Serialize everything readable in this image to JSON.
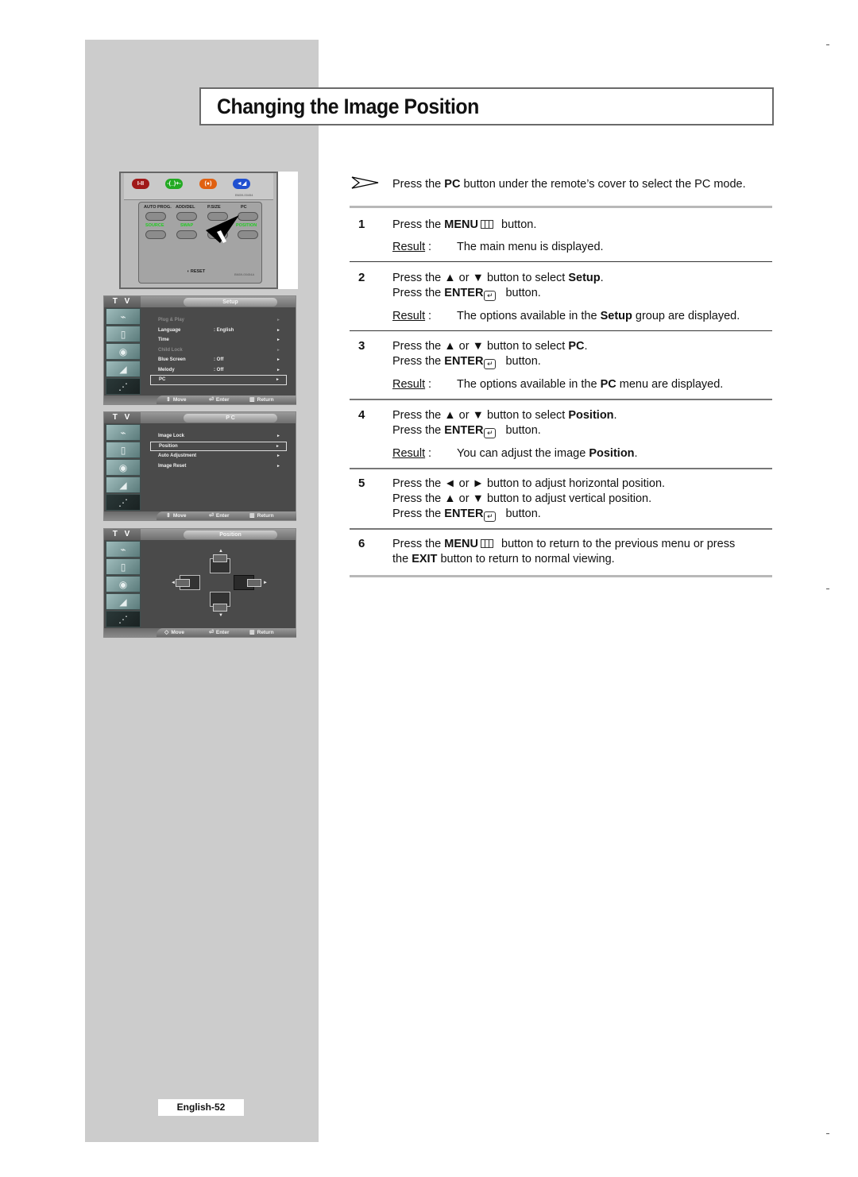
{
  "title": "Changing the Image Position",
  "remote": {
    "top_codes": "BN59-00454",
    "panel_code": "BN59-00454A",
    "top_buttons": [
      {
        "label": "I-II",
        "color": "#a01818"
      },
      {
        "label": "-(_)+-",
        "color": "#22aa22"
      },
      {
        "label": "(●)",
        "color": "#e06010"
      },
      {
        "label": "◄◢",
        "color": "#2050d0"
      }
    ],
    "row1_labels": [
      "AUTO PROG.",
      "ADD/DEL",
      "P.SIZE",
      "PC"
    ],
    "row2_labels": [
      "SOURCE",
      "SWAP",
      "",
      "POSITION"
    ],
    "reset_label": "RESET"
  },
  "screens": [
    {
      "tv_label": "T V",
      "tab": "Setup",
      "items": [
        {
          "label": "Plug & Play",
          "value": "",
          "dim": true,
          "selected": false
        },
        {
          "label": "Language",
          "value": ":  English",
          "dim": false,
          "selected": false
        },
        {
          "label": "Time",
          "value": "",
          "dim": false,
          "selected": false
        },
        {
          "label": "Child Lock",
          "value": "",
          "dim": true,
          "selected": false
        },
        {
          "label": "Blue Screen",
          "value": ":  Off",
          "dim": false,
          "selected": false
        },
        {
          "label": "Melody",
          "value": ":  Off",
          "dim": false,
          "selected": false
        },
        {
          "label": "PC",
          "value": "",
          "dim": false,
          "selected": true
        }
      ],
      "footer": {
        "move": "Move",
        "enter": "Enter",
        "return": "Return"
      }
    },
    {
      "tv_label": "T V",
      "tab": "P C",
      "items": [
        {
          "label": "Image Lock",
          "value": "",
          "dim": false,
          "selected": false
        },
        {
          "label": "Position",
          "value": "",
          "dim": false,
          "selected": true
        },
        {
          "label": "Auto Adjustment",
          "value": "",
          "dim": false,
          "selected": false
        },
        {
          "label": "Image Reset",
          "value": "",
          "dim": false,
          "selected": false
        }
      ],
      "footer": {
        "move": "Move",
        "enter": "Enter",
        "return": "Return"
      }
    },
    {
      "tv_label": "T V",
      "tab": "Position",
      "footer": {
        "move": "Move",
        "enter": "Enter",
        "return": "Return"
      }
    }
  ],
  "intro": {
    "pre": "Press the ",
    "bold": "PC",
    "post": " button under the remote’s cover to select the PC mode."
  },
  "result_label": "Result",
  "steps": [
    {
      "num": "1",
      "lines": [
        [
          "Press the ",
          "MENU",
          "",
          " button."
        ]
      ],
      "result": [
        "The main menu is displayed.",
        "",
        ""
      ]
    },
    {
      "num": "2",
      "lines": [
        [
          "Press the ▲ or ▼ button to select ",
          "Setup",
          "."
        ],
        [
          "Press the ",
          "ENTER",
          " button."
        ]
      ],
      "result": [
        "The options available in the ",
        "Setup",
        " group are displayed."
      ]
    },
    {
      "num": "3",
      "lines": [
        [
          "Press the ▲ or ▼ button to select ",
          "PC",
          "."
        ],
        [
          "Press the ",
          "ENTER",
          " button."
        ]
      ],
      "result": [
        "The options available in the ",
        "PC",
        " menu are displayed."
      ]
    },
    {
      "num": "4",
      "lines": [
        [
          "Press the ▲ or ▼ button to select ",
          "Position",
          "."
        ],
        [
          "Press the ",
          "ENTER",
          " button."
        ]
      ],
      "result": [
        "You can adjust the image ",
        "Position",
        "."
      ]
    },
    {
      "num": "5",
      "lines": [
        [
          "Press the ◄ or ► button to adjust horizontal position."
        ],
        [
          "Press the ▲ or ▼ button to adjust vertical position."
        ],
        [
          "Press the ",
          "ENTER",
          " button."
        ]
      ]
    },
    {
      "num": "6",
      "lines": [
        [
          "Press the ",
          "MENU",
          " button to return to the previous menu or press"
        ],
        [
          "the ",
          "EXIT",
          " button to return to normal viewing."
        ]
      ]
    }
  ],
  "footer": "English-52"
}
